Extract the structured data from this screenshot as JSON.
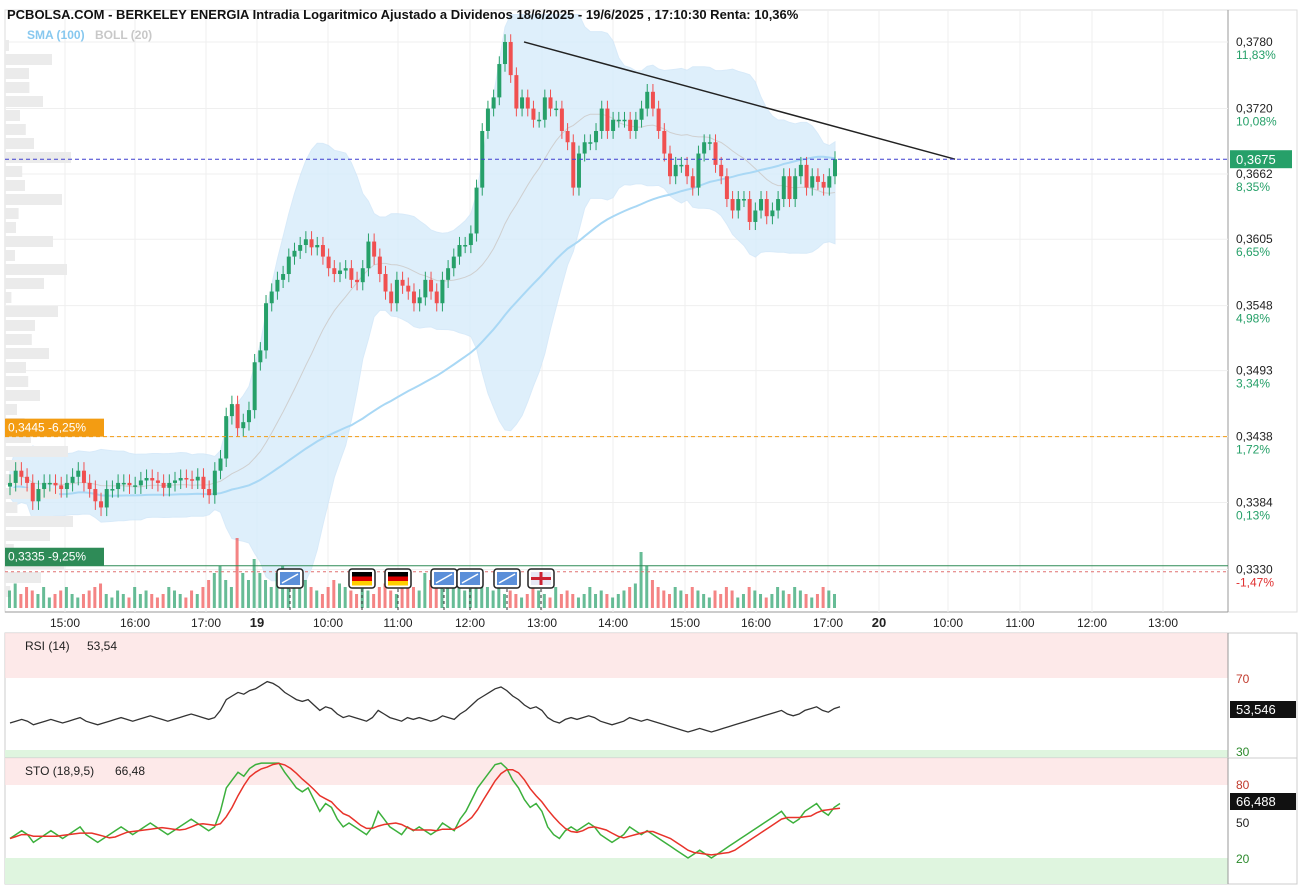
{
  "header": {
    "title": "PCBOLSA.COM - BERKELEY ENERGIA Intradia Logaritmico Ajustado a Dividenos 18/6/2025 - 19/6/2025 , 17:10:30 Renta: 10,36%",
    "sma_label": "SMA (100)",
    "boll_label": "BOLL (20)"
  },
  "colors": {
    "up": "#26a069",
    "down": "#f05050",
    "boll_fill": "#d6ecfb",
    "sma": "#a9d8f5",
    "trendline": "#222222",
    "current_line": "#3f3fcf",
    "orange_line": "#f39c12",
    "green_line": "#2e8b57",
    "rsi": "#333333",
    "sto_k": "#3cb03c",
    "sto_d": "#e8332a"
  },
  "price_axis": {
    "labels": [
      {
        "price": "0,3780",
        "pct": "11,83%"
      },
      {
        "price": "0,3720",
        "pct": "10,08%"
      },
      {
        "price": "0,3662",
        "pct": "8,35%"
      },
      {
        "price": "0,3605",
        "pct": "6,65%"
      },
      {
        "price": "0,3548",
        "pct": "4,98%"
      },
      {
        "price": "0,3493",
        "pct": "3,34%"
      },
      {
        "price": "0,3438",
        "pct": "1,72%"
      },
      {
        "price": "0,3384",
        "pct": "0,13%"
      },
      {
        "price": "0,3330",
        "pct": "-1,47%"
      }
    ],
    "current_price": "0,3675",
    "marker_orange": "0,3445  -6,25%",
    "marker_green": "0,3335  -9,25%"
  },
  "time_axis": [
    "15:00",
    "16:00",
    "17:00",
    "19",
    "10:00",
    "11:00",
    "12:00",
    "13:00",
    "14:00",
    "15:00",
    "16:00",
    "17:00",
    "20",
    "10:00",
    "11:00",
    "12:00",
    "13:00"
  ],
  "rsi_panel": {
    "label": "RSI (14)",
    "value": "53,54",
    "current": "53,546",
    "levels": [
      "70",
      "30"
    ]
  },
  "sto_panel": {
    "label": "STO (18,9,5)",
    "value": "66,48",
    "current": "66,488",
    "levels": [
      "80",
      "50",
      "20"
    ]
  },
  "event_flags": [
    {
      "icon": "chart-flag-icon"
    },
    {
      "icon": "germany-flag-icon"
    },
    {
      "icon": "germany-flag-icon"
    },
    {
      "icon": "chart-flag-icon"
    },
    {
      "icon": "chart-flag-icon"
    },
    {
      "icon": "chart-flag-icon"
    },
    {
      "icon": "uk-flag-icon"
    }
  ],
  "chart_data": {
    "type": "candlestick",
    "title": "PCBOLSA.COM - BERKELEY ENERGIA Intradia Logaritmico Ajustado a Dividenos 18/6/2025 - 19/6/2025 , 17:10:30 Renta: 10,36%",
    "scale": "log",
    "ylim": [
      0.332,
      0.38
    ],
    "x_ticks": [
      "15:00",
      "16:00",
      "17:00",
      "19",
      "10:00",
      "11:00",
      "12:00",
      "13:00",
      "14:00",
      "15:00",
      "16:00",
      "17:00",
      "20",
      "10:00",
      "11:00",
      "12:00",
      "13:00"
    ],
    "overlays": [
      "SMA (100)",
      "BOLL (20)"
    ],
    "close": [
      0.34,
      0.341,
      0.3405,
      0.34,
      0.3385,
      0.3395,
      0.34,
      0.34,
      0.3398,
      0.3395,
      0.34,
      0.3405,
      0.341,
      0.34,
      0.3395,
      0.3385,
      0.338,
      0.3395,
      0.3395,
      0.34,
      0.34,
      0.3398,
      0.3398,
      0.3402,
      0.3404,
      0.3402,
      0.34,
      0.3396,
      0.34,
      0.3402,
      0.3404,
      0.3403,
      0.3402,
      0.3405,
      0.3395,
      0.339,
      0.341,
      0.342,
      0.3455,
      0.3465,
      0.3445,
      0.345,
      0.346,
      0.35,
      0.351,
      0.355,
      0.356,
      0.357,
      0.3575,
      0.359,
      0.3595,
      0.36,
      0.3605,
      0.3598,
      0.36,
      0.359,
      0.358,
      0.3575,
      0.3578,
      0.358,
      0.357,
      0.3568,
      0.358,
      0.3603,
      0.359,
      0.3575,
      0.356,
      0.355,
      0.357,
      0.3565,
      0.356,
      0.355,
      0.3555,
      0.357,
      0.356,
      0.355,
      0.357,
      0.358,
      0.359,
      0.36,
      0.36,
      0.361,
      0.365,
      0.37,
      0.372,
      0.373,
      0.376,
      0.378,
      0.375,
      0.372,
      0.373,
      0.372,
      0.371,
      0.371,
      0.373,
      0.372,
      0.372,
      0.37,
      0.369,
      0.365,
      0.368,
      0.369,
      0.369,
      0.37,
      0.372,
      0.37,
      0.371,
      0.371,
      0.371,
      0.37,
      0.371,
      0.372,
      0.3735,
      0.372,
      0.37,
      0.368,
      0.366,
      0.367,
      0.367,
      0.366,
      0.365,
      0.368,
      0.369,
      0.369,
      0.367,
      0.366,
      0.364,
      0.363,
      0.364,
      0.364,
      0.362,
      0.363,
      0.364,
      0.3625,
      0.363,
      0.364,
      0.366,
      0.364,
      0.366,
      0.367,
      0.365,
      0.366,
      0.3655,
      0.365,
      0.366,
      0.3675
    ],
    "volume": [
      0.25,
      0.35,
      0.2,
      0.3,
      0.25,
      0.2,
      0.3,
      0.15,
      0.2,
      0.25,
      0.3,
      0.2,
      0.15,
      0.2,
      0.25,
      0.3,
      0.35,
      0.2,
      0.15,
      0.25,
      0.2,
      0.15,
      0.3,
      0.2,
      0.25,
      0.2,
      0.15,
      0.2,
      0.3,
      0.25,
      0.2,
      0.15,
      0.25,
      0.2,
      0.3,
      0.4,
      0.5,
      0.6,
      0.4,
      0.3,
      1.0,
      0.5,
      0.4,
      0.7,
      0.5,
      0.4,
      0.3,
      0.5,
      0.6,
      0.4,
      0.3,
      0.5,
      0.4,
      0.3,
      0.25,
      0.2,
      0.3,
      0.4,
      0.35,
      0.3,
      0.25,
      0.2,
      0.3,
      0.25,
      0.2,
      0.3,
      0.35,
      0.25,
      0.2,
      0.3,
      0.4,
      0.3,
      0.25,
      0.5,
      0.4,
      0.3,
      0.35,
      0.5,
      0.4,
      0.3,
      0.25,
      0.35,
      0.45,
      0.55,
      0.3,
      0.25,
      0.3,
      0.2,
      0.25,
      0.2,
      0.15,
      0.2,
      0.3,
      0.25,
      0.2,
      0.15,
      0.3,
      0.2,
      0.25,
      0.2,
      0.15,
      0.2,
      0.3,
      0.2,
      0.25,
      0.2,
      0.15,
      0.2,
      0.25,
      0.3,
      0.35,
      0.8,
      0.6,
      0.4,
      0.3,
      0.25,
      0.2,
      0.3,
      0.25,
      0.2,
      0.3,
      0.25,
      0.2,
      0.15,
      0.25,
      0.2,
      0.3,
      0.25,
      0.15,
      0.2,
      0.3,
      0.25,
      0.2,
      0.15,
      0.2,
      0.3,
      0.25,
      0.2,
      0.3,
      0.25,
      0.2,
      0.15,
      0.2,
      0.3,
      0.25,
      0.2
    ],
    "trendline": [
      [
        0.378,
        0.3675
      ]
    ],
    "rsi": [
      45,
      46,
      47,
      46,
      44,
      45,
      46,
      47,
      46,
      45,
      46,
      47,
      48,
      46,
      45,
      44,
      45,
      46,
      47,
      48,
      47,
      46,
      47,
      48,
      49,
      48,
      47,
      46,
      47,
      48,
      49,
      50,
      49,
      48,
      47,
      48,
      52,
      58,
      60,
      62,
      61,
      63,
      64,
      66,
      68,
      67,
      65,
      62,
      60,
      58,
      57,
      58,
      55,
      52,
      54,
      53,
      50,
      48,
      49,
      48,
      47,
      46,
      48,
      52,
      50,
      48,
      47,
      46,
      48,
      47,
      48,
      47,
      46,
      47,
      49,
      48,
      47,
      50,
      52,
      55,
      58,
      60,
      62,
      64,
      65,
      63,
      60,
      58,
      55,
      53,
      54,
      52,
      48,
      46,
      45,
      47,
      48,
      47,
      48,
      49,
      48,
      46,
      45,
      44,
      45,
      46,
      48,
      47,
      46,
      47,
      46,
      45,
      44,
      43,
      42,
      41,
      40,
      41,
      42,
      41,
      40,
      41,
      42,
      43,
      44,
      45,
      46,
      47,
      48,
      49,
      50,
      51,
      52,
      50,
      49,
      50,
      52,
      53,
      54,
      52,
      51,
      53,
      54
    ]
  }
}
